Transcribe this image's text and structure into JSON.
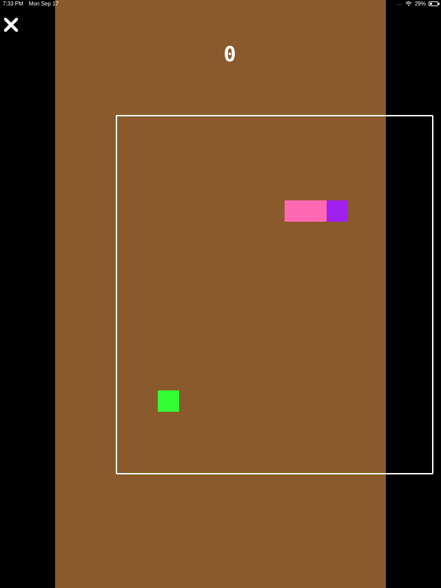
{
  "status_bar": {
    "time": "7:33 PM",
    "date": "Mon Sep 17",
    "signal": ".....",
    "battery_percent": "29%",
    "battery_level": 0.29
  },
  "icons": {
    "close": "close-icon",
    "wifi": "wifi-icon",
    "battery": "battery-icon"
  },
  "game": {
    "score": "0",
    "colors": {
      "background": "#8a5a2c",
      "border": "#ffffff",
      "snake_body": "#ff69b4",
      "snake_head": "#a020f0",
      "food": "#33ff33",
      "letterbox": "#000000"
    },
    "grid": {
      "cols": 15,
      "rows": 17
    },
    "snake": [
      {
        "col": 8,
        "row": 4,
        "part": "body"
      },
      {
        "col": 9,
        "row": 4,
        "part": "body"
      },
      {
        "col": 10,
        "row": 4,
        "part": "head"
      }
    ],
    "food": {
      "col": 2,
      "row": 13
    }
  }
}
